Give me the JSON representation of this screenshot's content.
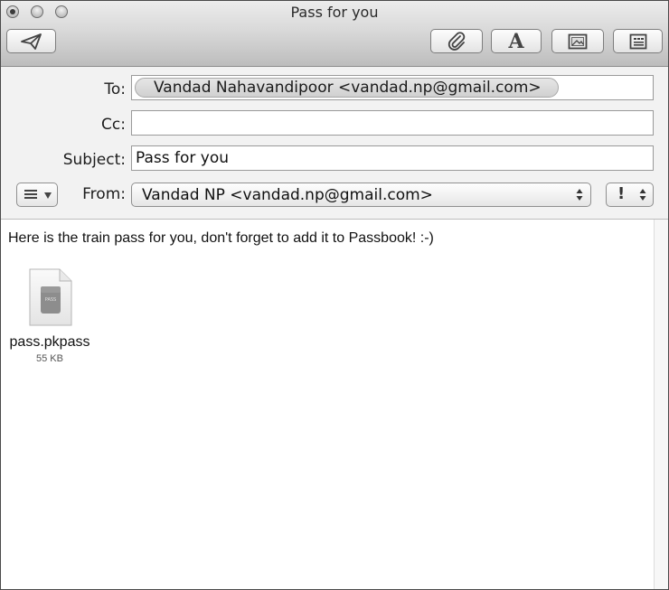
{
  "window": {
    "title": "Pass for you"
  },
  "toolbar": {
    "buttons": [
      {
        "name": "send",
        "icon": "paper-plane-icon"
      },
      {
        "name": "attach",
        "icon": "paperclip-icon"
      },
      {
        "name": "fonts",
        "icon": "font-icon",
        "glyph": "A"
      },
      {
        "name": "photo-browser",
        "icon": "photo-icon"
      },
      {
        "name": "stationery",
        "icon": "stationery-icon"
      }
    ]
  },
  "header": {
    "to_label": "To:",
    "to_recipient": "Vandad Nahavandipoor <vandad.np@gmail.com>",
    "cc_label": "Cc:",
    "cc_value": "",
    "subject_label": "Subject:",
    "subject_value": "Pass for you",
    "from_label": "From:",
    "from_value": "Vandad NP <vandad.np@gmail.com>",
    "priority_glyph": "!"
  },
  "body": {
    "text": "Here is the train pass for you, don't forget to add it to Passbook! :-)",
    "attachment": {
      "filename": "pass.pkpass",
      "size": "55 KB",
      "badge": "PASS",
      "icon": "pkpass-document-icon"
    }
  }
}
